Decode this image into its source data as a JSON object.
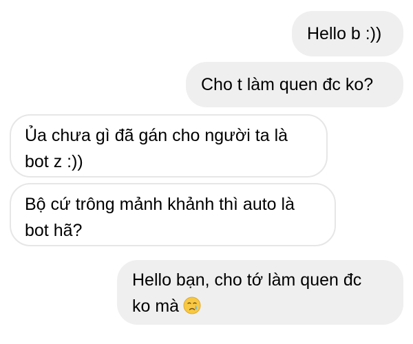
{
  "messages": [
    {
      "sender": "me",
      "lines": [
        "Hello b :))"
      ]
    },
    {
      "sender": "me",
      "lines": [
        "Cho t làm quen đc ko?"
      ]
    },
    {
      "sender": "them",
      "lines": [
        "Ủa chưa gì đã gán cho người ta là",
        "bot z :))"
      ]
    },
    {
      "sender": "them",
      "lines": [
        "Bộ cứ trông mảnh khảnh thì auto là",
        "bot hã?"
      ]
    },
    {
      "sender": "me",
      "lines": [
        "Hello bạn, cho tớ làm quen đc",
        "ko mà"
      ],
      "emoji": "crying-face-emoji"
    }
  ],
  "colors": {
    "outgoing_bubble": "#efefef",
    "incoming_bubble": "#ffffff",
    "incoming_border": "#e6e6e6",
    "text": "#000000"
  }
}
